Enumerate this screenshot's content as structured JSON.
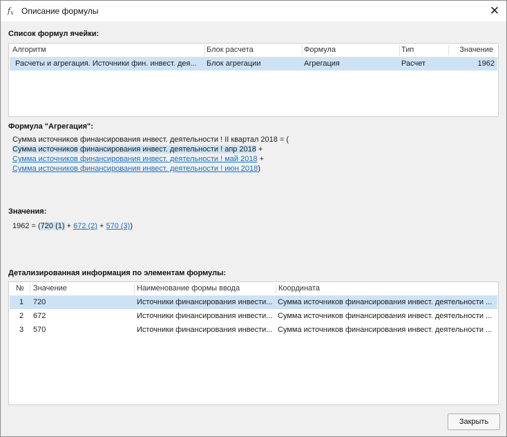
{
  "window": {
    "title": "Описание формулы",
    "title_icon": "fx-icon",
    "close_icon": "close-icon",
    "close_glyph": "✕"
  },
  "formulas_list": {
    "label": "Список формул ячейки:",
    "columns": [
      "Алгоритм",
      "Блок расчета",
      "Формула",
      "Тип",
      "Значение"
    ],
    "rows": [
      {
        "algorithm": "Расчеты и агрегация. Источники фин. инвест. дея...",
        "block": "Блок агрегации",
        "formula": "Агрегация",
        "type": "Расчет",
        "value": "1962",
        "selected": true
      }
    ]
  },
  "formula": {
    "label": "Формула \"Агрегация\":",
    "line1": "Сумма источников финансирования инвест. деятельности ! II квартал 2018 = (",
    "line2_text": "Сумма источников финансирования инвест. деятельности ! апр 2018",
    "line2_op": " +",
    "line3_link": "Сумма источников финансирования инвест. деятельности ! май 2018",
    "line3_op": " +",
    "line4_link": "Сумма источников финансирования инвест. деятельности ! июн 2018",
    "line4_close": ")"
  },
  "values": {
    "label": "Значения:",
    "prefix": "1962 = (",
    "term1": "720 (1)",
    "op1": " + ",
    "term2": "672 (2)",
    "op2": " + ",
    "term3": "570 (3)",
    "suffix": ")"
  },
  "details": {
    "label": "Детализированная информация по элементам формулы:",
    "columns": [
      "№",
      "Значение",
      "Наименование формы ввода",
      "Координата"
    ],
    "rows": [
      {
        "n": "1",
        "value": "720",
        "form": "Источники финансирования инвести...",
        "coord": "Сумма источников финансирования инвест. деятельности ...",
        "selected": true
      },
      {
        "n": "2",
        "value": "672",
        "form": "Источники финансирования инвести...",
        "coord": "Сумма источников финансирования инвест. деятельности ...",
        "selected": false
      },
      {
        "n": "3",
        "value": "570",
        "form": "Источники финансирования инвести...",
        "coord": "Сумма источников финансирования инвест. деятельности ...",
        "selected": false
      }
    ]
  },
  "buttons": {
    "close_label": "Закрыть"
  },
  "colors": {
    "selection": "#cde3f5",
    "link": "#1e6fb8"
  }
}
